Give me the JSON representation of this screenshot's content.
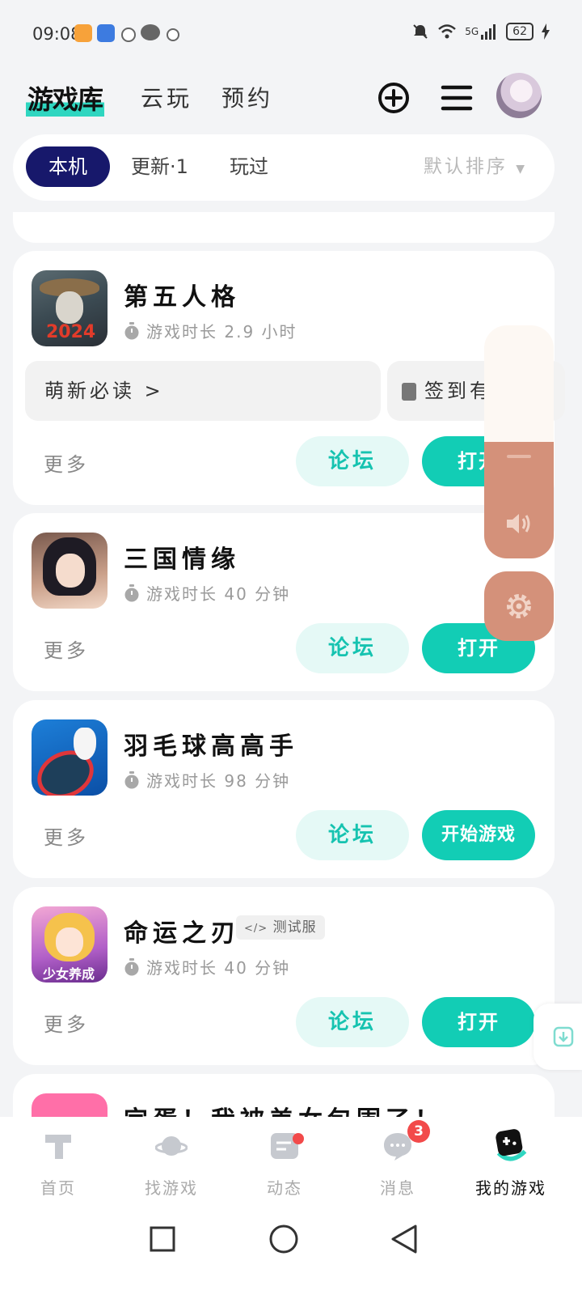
{
  "status_bar": {
    "time": "09:08",
    "network": "5G",
    "battery": "62"
  },
  "header": {
    "brand": "游戏库",
    "tabs": [
      "云玩",
      "预约"
    ],
    "icons": [
      "add-circle-icon",
      "menu-icon"
    ]
  },
  "filter": {
    "chips": [
      "本机",
      "更新·1",
      "玩过"
    ],
    "active_chip": "本机",
    "sort_label": "默认排序"
  },
  "games": [
    {
      "name": "第五人格",
      "playtime": "游戏时长 2.9 小时",
      "icon_text": "2024",
      "sub_buttons": [
        "萌新必读 >",
        "签到有"
      ],
      "more": "更多",
      "forum": "论坛",
      "action": "打开"
    },
    {
      "name": "三国情缘",
      "playtime": "游戏时长 40 分钟",
      "more": "更多",
      "forum": "论坛",
      "action": "打开"
    },
    {
      "name": "羽毛球高高手",
      "playtime": "游戏时长 98 分钟",
      "more": "更多",
      "forum": "论坛",
      "action": "开始游戏"
    },
    {
      "name": "命运之刃",
      "badge": "测试服",
      "playtime": "游戏时长 40 分钟",
      "icon_text": "少女养成",
      "more": "更多",
      "forum": "论坛",
      "action": "打开"
    },
    {
      "name": "完蛋！我被美女包围了！"
    }
  ],
  "volume": {
    "level_fraction": 0.5
  },
  "bottom_nav": [
    {
      "label": "首页",
      "icon": "home-icon"
    },
    {
      "label": "找游戏",
      "icon": "planet-icon"
    },
    {
      "label": "动态",
      "icon": "feed-icon",
      "dot": true
    },
    {
      "label": "消息",
      "icon": "message-icon",
      "badge": "3"
    },
    {
      "label": "我的游戏",
      "icon": "gamepad-icon",
      "active": true
    }
  ],
  "colors": {
    "accent": "#12cdb5",
    "active_chip": "#17186b",
    "volume": "#d4917a",
    "badge": "#f24a4a"
  }
}
